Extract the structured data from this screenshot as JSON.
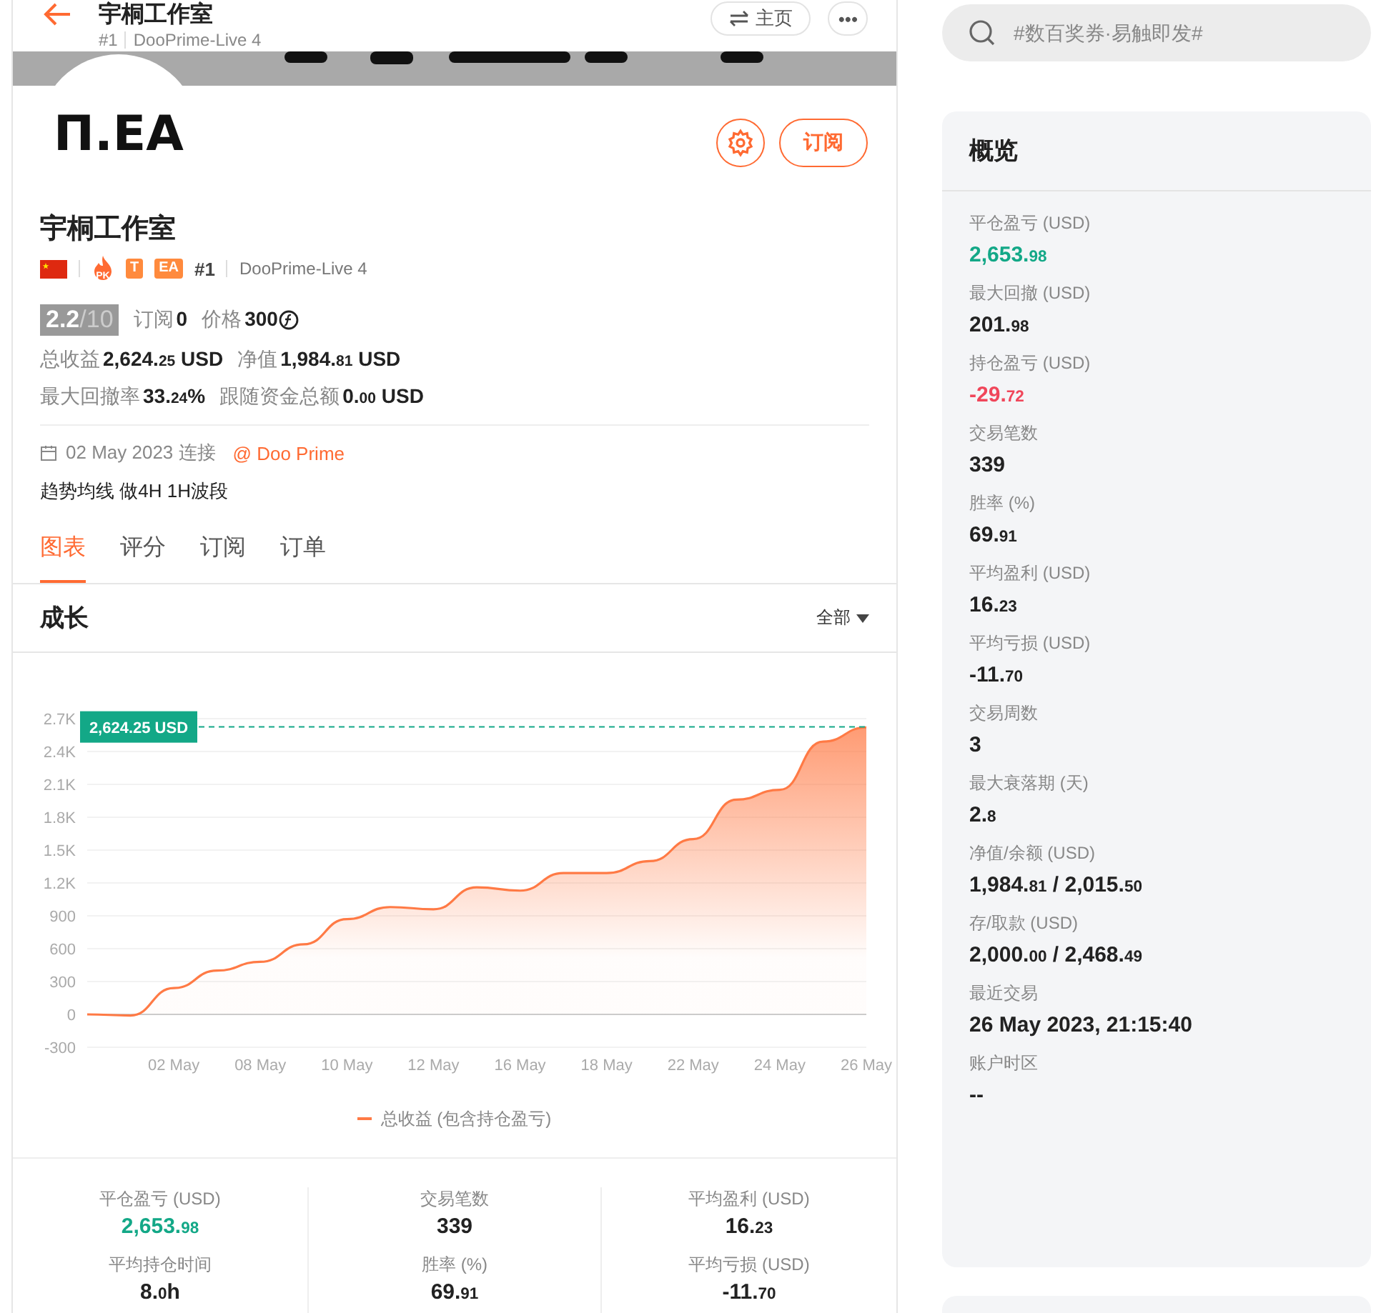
{
  "header": {
    "title": "宇桐工作室",
    "rank": "#1",
    "server": "DooPrime-Live 4",
    "home_button": "主页",
    "more_button": "•••"
  },
  "profile": {
    "avatar_text": "П.EA",
    "subscribe_button": "订阅",
    "name": "宇桐工作室",
    "badges": [
      {
        "kind": "flag"
      },
      {
        "kind": "fire",
        "label": "PK"
      },
      {
        "kind": "tag",
        "label": "T"
      },
      {
        "kind": "tag",
        "label": "EA"
      }
    ],
    "rank": "#1",
    "server": "DooPrime-Live 4",
    "score": "2.2",
    "score_max": "/10",
    "subs_label": "订阅",
    "subs": "0",
    "price_label": "价格",
    "price": "300",
    "stats": [
      [
        {
          "label": "总收益",
          "value": "2,624.25 USD"
        },
        {
          "label": "净值",
          "value": "1,984.81 USD"
        }
      ],
      [
        {
          "label": "最大回撤率",
          "value": "33.24%"
        },
        {
          "label": "跟随资金总额",
          "value": "0.00 USD"
        }
      ]
    ],
    "since": "02 May 2023 连接",
    "broker": "@ Doo Prime",
    "description": "趋势均线 做4H 1H波段"
  },
  "tabs": [
    {
      "label": "图表",
      "selected": true
    },
    {
      "label": "评分",
      "selected": false
    },
    {
      "label": "订阅",
      "selected": false
    },
    {
      "label": "订单",
      "selected": false
    }
  ],
  "growth": {
    "title": "成长",
    "range": "全部",
    "chart_data": {
      "type": "area",
      "grid": true,
      "ref_lines": [
        {
          "axis": "y",
          "value": 2624.25,
          "label": "2,624.25 USD",
          "color": "#13a887"
        }
      ],
      "categories": [
        null,
        null,
        "02 May",
        null,
        "08 May",
        null,
        "10 May",
        null,
        "12 May",
        null,
        "16 May",
        null,
        "18 May",
        null,
        "22 May",
        null,
        "24 May",
        null,
        "26 May"
      ],
      "series": [
        {
          "name": "总收益 (包含持仓盈亏)",
          "color": "#ff7a45",
          "values": [
            0,
            -10,
            240,
            400,
            480,
            640,
            870,
            980,
            960,
            1160,
            1130,
            1290,
            1290,
            1400,
            1600,
            1960,
            2050,
            2490,
            2620
          ]
        }
      ],
      "ylim": [
        -300,
        2700
      ],
      "yticks": [
        -300,
        0,
        300,
        600,
        900,
        {
          "value": 1200,
          "label": "1.2K"
        },
        {
          "value": 1500,
          "label": "1.5K"
        },
        {
          "value": 1800,
          "label": "1.8K"
        },
        {
          "value": 2100,
          "label": "2.1K"
        },
        {
          "value": 2400,
          "label": "2.4K"
        },
        {
          "value": 2700,
          "label": "2.7K"
        }
      ]
    }
  },
  "summary": [
    {
      "label": "平仓盈亏 (USD)",
      "value": "2,653.98",
      "color": "#13a887"
    },
    {
      "label": "交易笔数",
      "value": "339",
      "color": "#222222"
    },
    {
      "label": "平均盈利 (USD)",
      "value": "16.23",
      "color": "#222222"
    },
    {
      "label": "平均持仓时间",
      "value": "8.0h",
      "color": "#222222"
    },
    {
      "label": "胜率 (%)",
      "value": "69.91",
      "color": "#222222"
    },
    {
      "label": "平均亏损 (USD)",
      "value": "-11.70",
      "color": "#222222"
    }
  ],
  "search": {
    "placeholder": "#数百奖券·易触即发#"
  },
  "overview": {
    "title": "概览",
    "items": [
      {
        "label": "平仓盈亏 (USD)",
        "value": "2,653.98",
        "color": "#13a887"
      },
      {
        "label": "最大回撤 (USD)",
        "value": "201.98",
        "color": "#222222"
      },
      {
        "label": "持仓盈亏 (USD)",
        "value": "-29.72",
        "color": "#f0465a"
      },
      {
        "label": "交易笔数",
        "value": "339",
        "color": "#222222"
      },
      {
        "label": "胜率 (%)",
        "value": "69.91",
        "color": "#222222"
      },
      {
        "label": "平均盈利 (USD)",
        "value": "16.23",
        "color": "#222222"
      },
      {
        "label": "平均亏损 (USD)",
        "value": "-11.70",
        "color": "#222222"
      },
      {
        "label": "交易周数",
        "value": "3",
        "color": "#222222"
      },
      {
        "label": "最大衰落期 (天)",
        "value": "2.8",
        "color": "#222222"
      },
      {
        "label": "净值/余额 (USD)",
        "value": "1,984.81 / 2,015.50",
        "color": "#222222"
      },
      {
        "label": "存/取款 (USD)",
        "value": "2,000.00 / 2,468.49",
        "color": "#222222"
      },
      {
        "label": "最近交易",
        "value": "26 May 2023, 21:15:40",
        "color": "#222222"
      },
      {
        "label": "账户时区",
        "value": "--",
        "color": "#222222"
      }
    ]
  }
}
